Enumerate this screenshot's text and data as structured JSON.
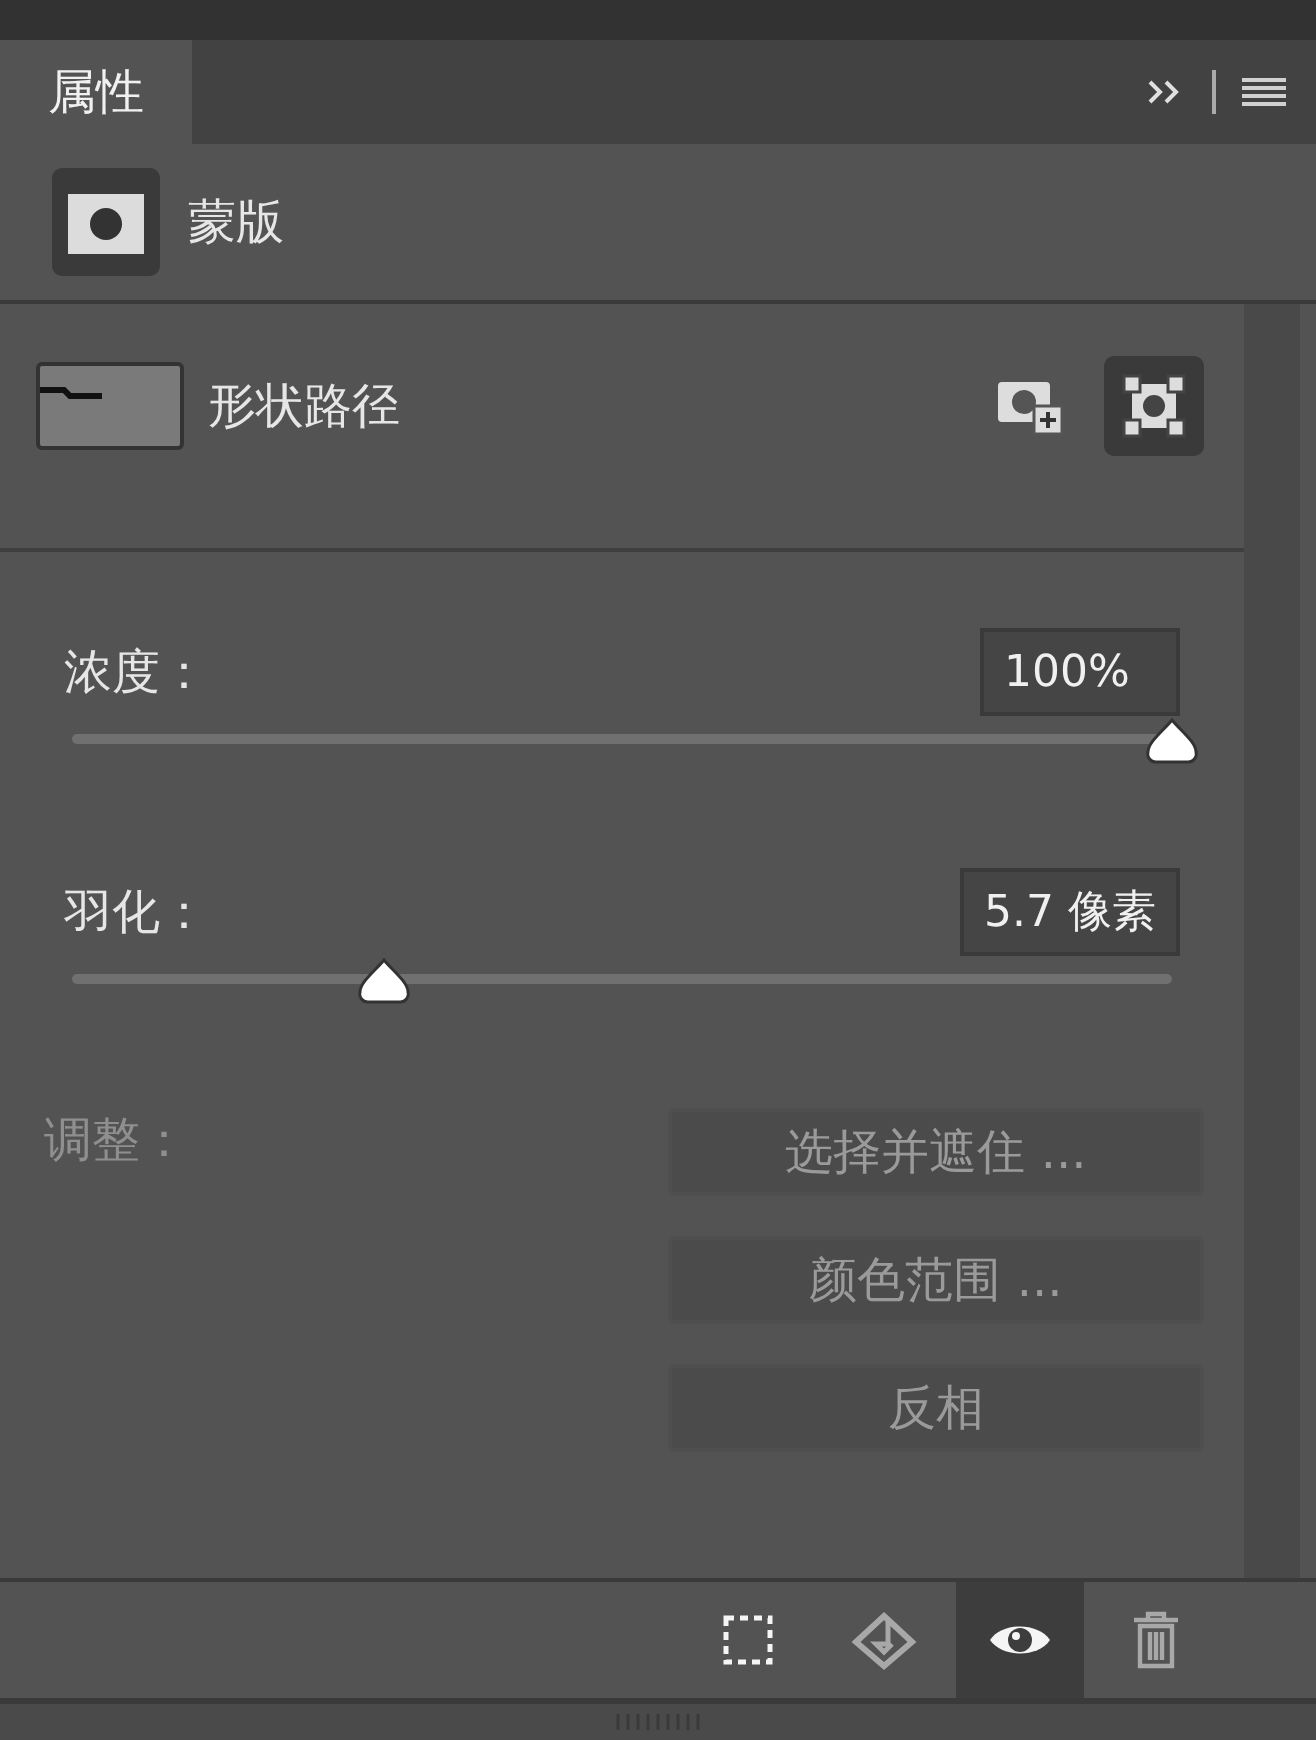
{
  "tabs": [
    {
      "label": "属性",
      "selected": true
    }
  ],
  "mask_header": {
    "label": "蒙版"
  },
  "shape_path": {
    "label": "形状路径"
  },
  "mask_buttons": [
    {
      "kind": "pixel",
      "selected": false
    },
    {
      "kind": "vector",
      "selected": true
    }
  ],
  "sliders": [
    {
      "label": "浓度：",
      "value": "100%",
      "level": 1.0
    },
    {
      "label": "羽化：",
      "value": "5.7 像素",
      "level": 0.284
    }
  ],
  "adjust": {
    "label": "调整：",
    "disabled": true,
    "buttons": [
      "选择并遮住 ...",
      "颜色范围 ...",
      "反相"
    ]
  },
  "footer_tools": [
    {
      "kind": "selection",
      "selected": false,
      "disabled": false
    },
    {
      "kind": "apply",
      "selected": false,
      "disabled": true
    },
    {
      "kind": "visibility",
      "selected": true,
      "disabled": false
    },
    {
      "kind": "delete",
      "selected": false,
      "disabled": true
    }
  ]
}
